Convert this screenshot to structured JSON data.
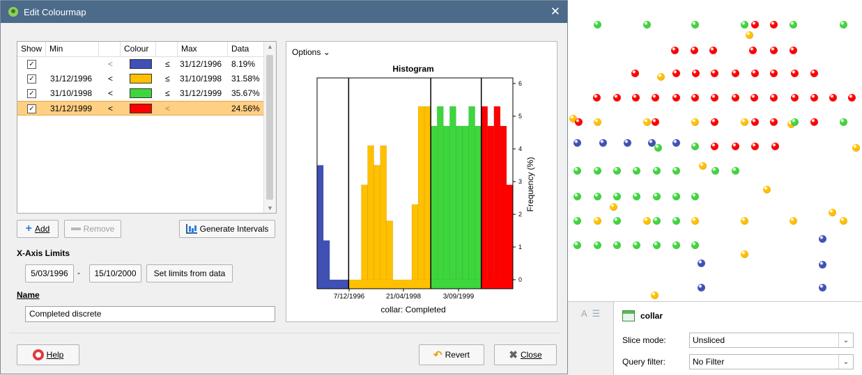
{
  "dialog": {
    "title": "Edit Colourmap",
    "close_glyph": "✕"
  },
  "intervals": {
    "columns": [
      "Show",
      "Min",
      "",
      "Colour",
      "",
      "Max",
      "Data"
    ],
    "rows": [
      {
        "show": true,
        "min": "",
        "op_min": "<",
        "colour": "#3f51b5",
        "op_max": "≤",
        "max": "31/12/1996",
        "data": "8.19%",
        "selected": false
      },
      {
        "show": true,
        "min": "31/12/1996",
        "op_min": "<",
        "colour": "#ffc000",
        "op_max": "≤",
        "max": "31/10/1998",
        "data": "31.58%",
        "selected": false
      },
      {
        "show": true,
        "min": "31/10/1998",
        "op_min": "<",
        "colour": "#3dd63d",
        "op_max": "≤",
        "max": "31/12/1999",
        "data": "35.67%",
        "selected": false
      },
      {
        "show": true,
        "min": "31/12/1999",
        "op_min": "<",
        "colour": "#ff0000",
        "op_max": "<",
        "max": "",
        "data": "24.56%",
        "selected": true
      }
    ]
  },
  "buttons": {
    "add": "Add",
    "remove": "Remove",
    "generate": "Generate Intervals",
    "set_limits": "Set limits from data",
    "help": "Help",
    "revert": "Revert",
    "close": "Close"
  },
  "xaxis_limits": {
    "label": "X-Axis Limits",
    "from": "5/03/1996",
    "separator": "-",
    "to": "15/10/2000"
  },
  "name": {
    "label": "Name",
    "value": "Completed discrete"
  },
  "histogram": {
    "options_label": "Options ⌄",
    "title": "Histogram",
    "xlabel": "collar: Completed",
    "ylabel": "Frequency (%)",
    "x_ticks": [
      "7/12/1996",
      "21/04/1998",
      "3/09/1999"
    ],
    "y_ticks": [
      "0",
      "1",
      "2",
      "3",
      "4",
      "5",
      "6"
    ]
  },
  "chart_data": {
    "type": "bar",
    "title": "Histogram",
    "xlabel": "collar: Completed",
    "ylabel": "Frequency (%)",
    "ylim": [
      0,
      6
    ],
    "x_tick_labels": [
      "7/12/1996",
      "21/04/1998",
      "3/09/1999"
    ],
    "bins": [
      {
        "value": 3.5,
        "colour": "#3f51b5"
      },
      {
        "value": 1.2,
        "colour": "#3f51b5"
      },
      {
        "value": 0,
        "colour": "#3f51b5"
      },
      {
        "value": 0,
        "colour": "#3f51b5"
      },
      {
        "value": 0,
        "colour": "#3f51b5"
      },
      {
        "value": 0,
        "colour": "#ffc000"
      },
      {
        "value": 0,
        "colour": "#ffc000"
      },
      {
        "value": 2.9,
        "colour": "#ffc000"
      },
      {
        "value": 4.1,
        "colour": "#ffc000"
      },
      {
        "value": 3.5,
        "colour": "#ffc000"
      },
      {
        "value": 4.1,
        "colour": "#ffc000"
      },
      {
        "value": 1.8,
        "colour": "#ffc000"
      },
      {
        "value": 0,
        "colour": "#ffc000"
      },
      {
        "value": 0,
        "colour": "#ffc000"
      },
      {
        "value": 0,
        "colour": "#ffc000"
      },
      {
        "value": 2.3,
        "colour": "#ffc000"
      },
      {
        "value": 5.3,
        "colour": "#ffc000"
      },
      {
        "value": 5.3,
        "colour": "#ffc000"
      },
      {
        "value": 4.7,
        "colour": "#3dd63d"
      },
      {
        "value": 5.3,
        "colour": "#3dd63d"
      },
      {
        "value": 4.7,
        "colour": "#3dd63d"
      },
      {
        "value": 5.3,
        "colour": "#3dd63d"
      },
      {
        "value": 4.7,
        "colour": "#3dd63d"
      },
      {
        "value": 4.7,
        "colour": "#3dd63d"
      },
      {
        "value": 5.3,
        "colour": "#3dd63d"
      },
      {
        "value": 4.7,
        "colour": "#3dd63d"
      },
      {
        "value": 5.3,
        "colour": "#ff0000"
      },
      {
        "value": 4.7,
        "colour": "#ff0000"
      },
      {
        "value": 5.3,
        "colour": "#ff0000"
      },
      {
        "value": 4.7,
        "colour": "#ff0000"
      },
      {
        "value": 2.9,
        "colour": "#ff0000"
      }
    ]
  },
  "properties": {
    "object_name": "collar",
    "slice_mode_label": "Slice mode:",
    "slice_mode_value": "Unsliced",
    "query_filter_label": "Query filter:",
    "query_filter_value": "No Filter"
  },
  "colors": {
    "titlebar": "#4c6a8a",
    "selection": "#ffcf84",
    "blue": "#3f51b5",
    "orange": "#ffc000",
    "green": "#3dd63d",
    "red": "#ff0000"
  }
}
